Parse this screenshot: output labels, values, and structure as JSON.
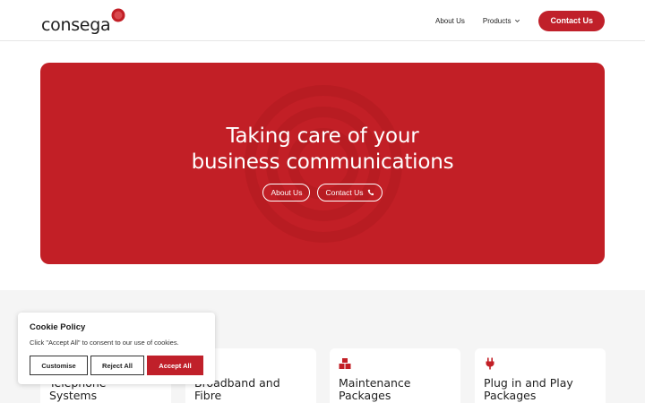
{
  "header": {
    "logo_text": "consega",
    "nav": {
      "about": "About Us",
      "products": "Products",
      "contact": "Contact Us"
    }
  },
  "hero": {
    "title_line1": "Taking care of your",
    "title_line2": "business communications",
    "button_about": "About Us",
    "button_contact": "Contact Us"
  },
  "cards": [
    {
      "title_line1": "Telephone",
      "title_line2": "Systems",
      "icon": "phone-icon"
    },
    {
      "title_line1": "Broadband and",
      "title_line2": "Fibre",
      "icon": "wifi-icon"
    },
    {
      "title_line1": "Maintenance",
      "title_line2": "Packages",
      "icon": "boxes-icon"
    },
    {
      "title_line1": "Plug in and Play",
      "title_line2": "Packages",
      "icon": "plug-icon"
    }
  ],
  "cookie": {
    "title": "Cookie Policy",
    "text": "Click \"Accept All\" to consent to our use of cookies.",
    "customise": "Customise",
    "reject": "Reject All",
    "accept": "Accept All"
  },
  "colors": {
    "brand_red": "#c21f26",
    "section_bg": "#f5f5f5"
  }
}
